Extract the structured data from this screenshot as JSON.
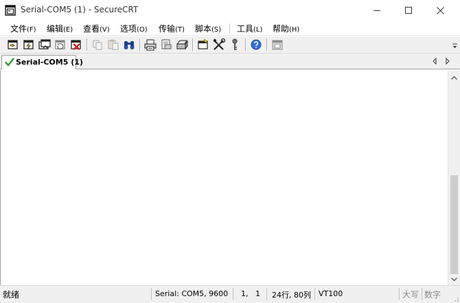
{
  "window": {
    "title": "Serial-COM5 (1) - SecureCRT"
  },
  "menu": [
    {
      "label": "文件",
      "accel": "(F)"
    },
    {
      "label": "编辑",
      "accel": "(E)"
    },
    {
      "label": "查看",
      "accel": "(V)"
    },
    {
      "label": "选项",
      "accel": "(O)"
    },
    {
      "label": "传输",
      "accel": "(T)"
    },
    {
      "label": "脚本",
      "accel": "(S)"
    },
    {
      "label": "工具",
      "accel": "(L)"
    },
    {
      "label": "帮助",
      "accel": "(H)"
    }
  ],
  "toolbar": {
    "buttons": [
      "connect-icon",
      "quick-connect-icon",
      "connect-in-tab-icon",
      "reconnect-icon",
      "disconnect-icon",
      "copy-icon",
      "paste-icon",
      "find-icon",
      "print-icon",
      "print-setup-icon",
      "print-selection-icon",
      "session-options-icon",
      "global-options-icon",
      "keymap-icon",
      "help-icon",
      "sftp-icon"
    ]
  },
  "tabs": [
    {
      "label": "Serial-COM5 (1)",
      "status": "connected"
    }
  ],
  "status": {
    "ready": "就绪",
    "connection": "Serial: COM5, 9600",
    "cursor": "1,   1",
    "size": "24行, 80列",
    "emulation": "VT100",
    "caps": "大写",
    "num": "数字"
  },
  "colors": {
    "check_green": "#2e9b2e",
    "help_blue": "#2f6fd6"
  }
}
